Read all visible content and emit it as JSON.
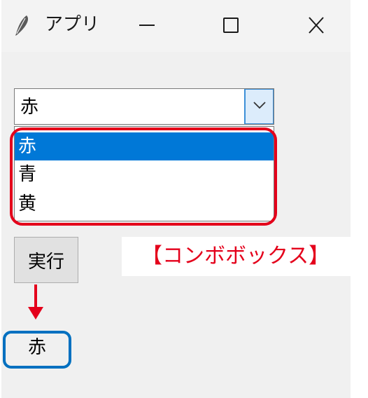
{
  "window": {
    "title": "アプリ",
    "icon": "feather-icon",
    "controls": [
      "minimize-icon",
      "maximize-icon",
      "close-icon"
    ]
  },
  "combobox": {
    "value": "赤",
    "options": [
      "赤",
      "青",
      "黄"
    ],
    "selected_index": 0
  },
  "run_button": {
    "label": "実行"
  },
  "annotation": {
    "caption": "【コンボボックス】"
  },
  "result": {
    "text": "赤"
  },
  "colors": {
    "highlight_red": "#e4001b",
    "highlight_blue": "#0070c0",
    "selection": "#0078d7"
  }
}
